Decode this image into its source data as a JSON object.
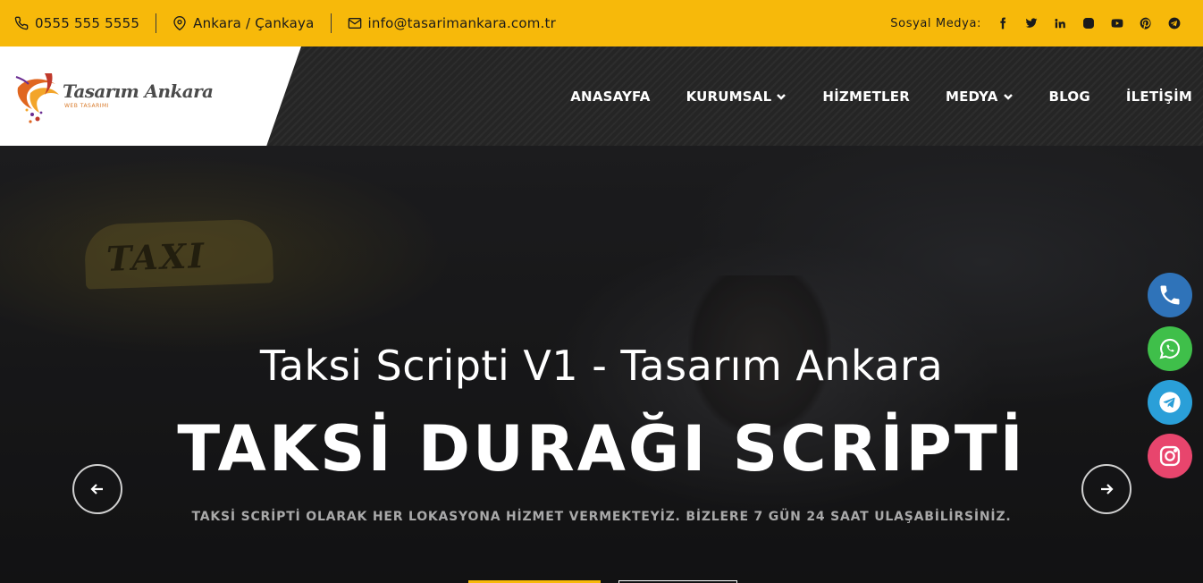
{
  "topbar": {
    "phone": "0555 555 5555",
    "location": "Ankara / Çankaya",
    "email": "info@tasarimankara.com.tr",
    "social_label": "Sosyal Medya:",
    "social_icons": [
      "facebook-icon",
      "twitter-icon",
      "linkedin-icon",
      "instagram-icon",
      "youtube-icon",
      "pinterest-icon",
      "telegram-icon"
    ]
  },
  "brand": {
    "name": "Tasarım Ankara",
    "tagline": "WEB TASARIMI"
  },
  "nav": {
    "items": [
      {
        "label": "ANASAYFA",
        "dropdown": false
      },
      {
        "label": "KURUMSAL",
        "dropdown": true
      },
      {
        "label": "HİZMETLER",
        "dropdown": false
      },
      {
        "label": "MEDYA",
        "dropdown": true
      },
      {
        "label": "BLOG",
        "dropdown": false
      },
      {
        "label": "İLETİŞİM",
        "dropdown": false
      }
    ]
  },
  "hero": {
    "image_sign_text": "TAXI",
    "subtitle": "Taksi Scripti V1 - Tasarım Ankara",
    "title": "TAKSİ DURAĞI SCRİPTİ",
    "description": "TAKSİ SCRİPTİ OLARAK HER LOKASYONA HİZMET VERMEKTEYİZ. BİZLERE 7 GÜN 24 SAAT ULAŞABİLİRSİNİZ."
  },
  "floating": {
    "buttons": [
      {
        "name": "phone",
        "color": "#2f73b9"
      },
      {
        "name": "whatsapp",
        "color": "#3fbf4a"
      },
      {
        "name": "telegram",
        "color": "#2a9fd8"
      },
      {
        "name": "instagram",
        "color": "#e8456d"
      }
    ]
  },
  "colors": {
    "accent": "#f7b90a",
    "header_bg": "#252525"
  }
}
